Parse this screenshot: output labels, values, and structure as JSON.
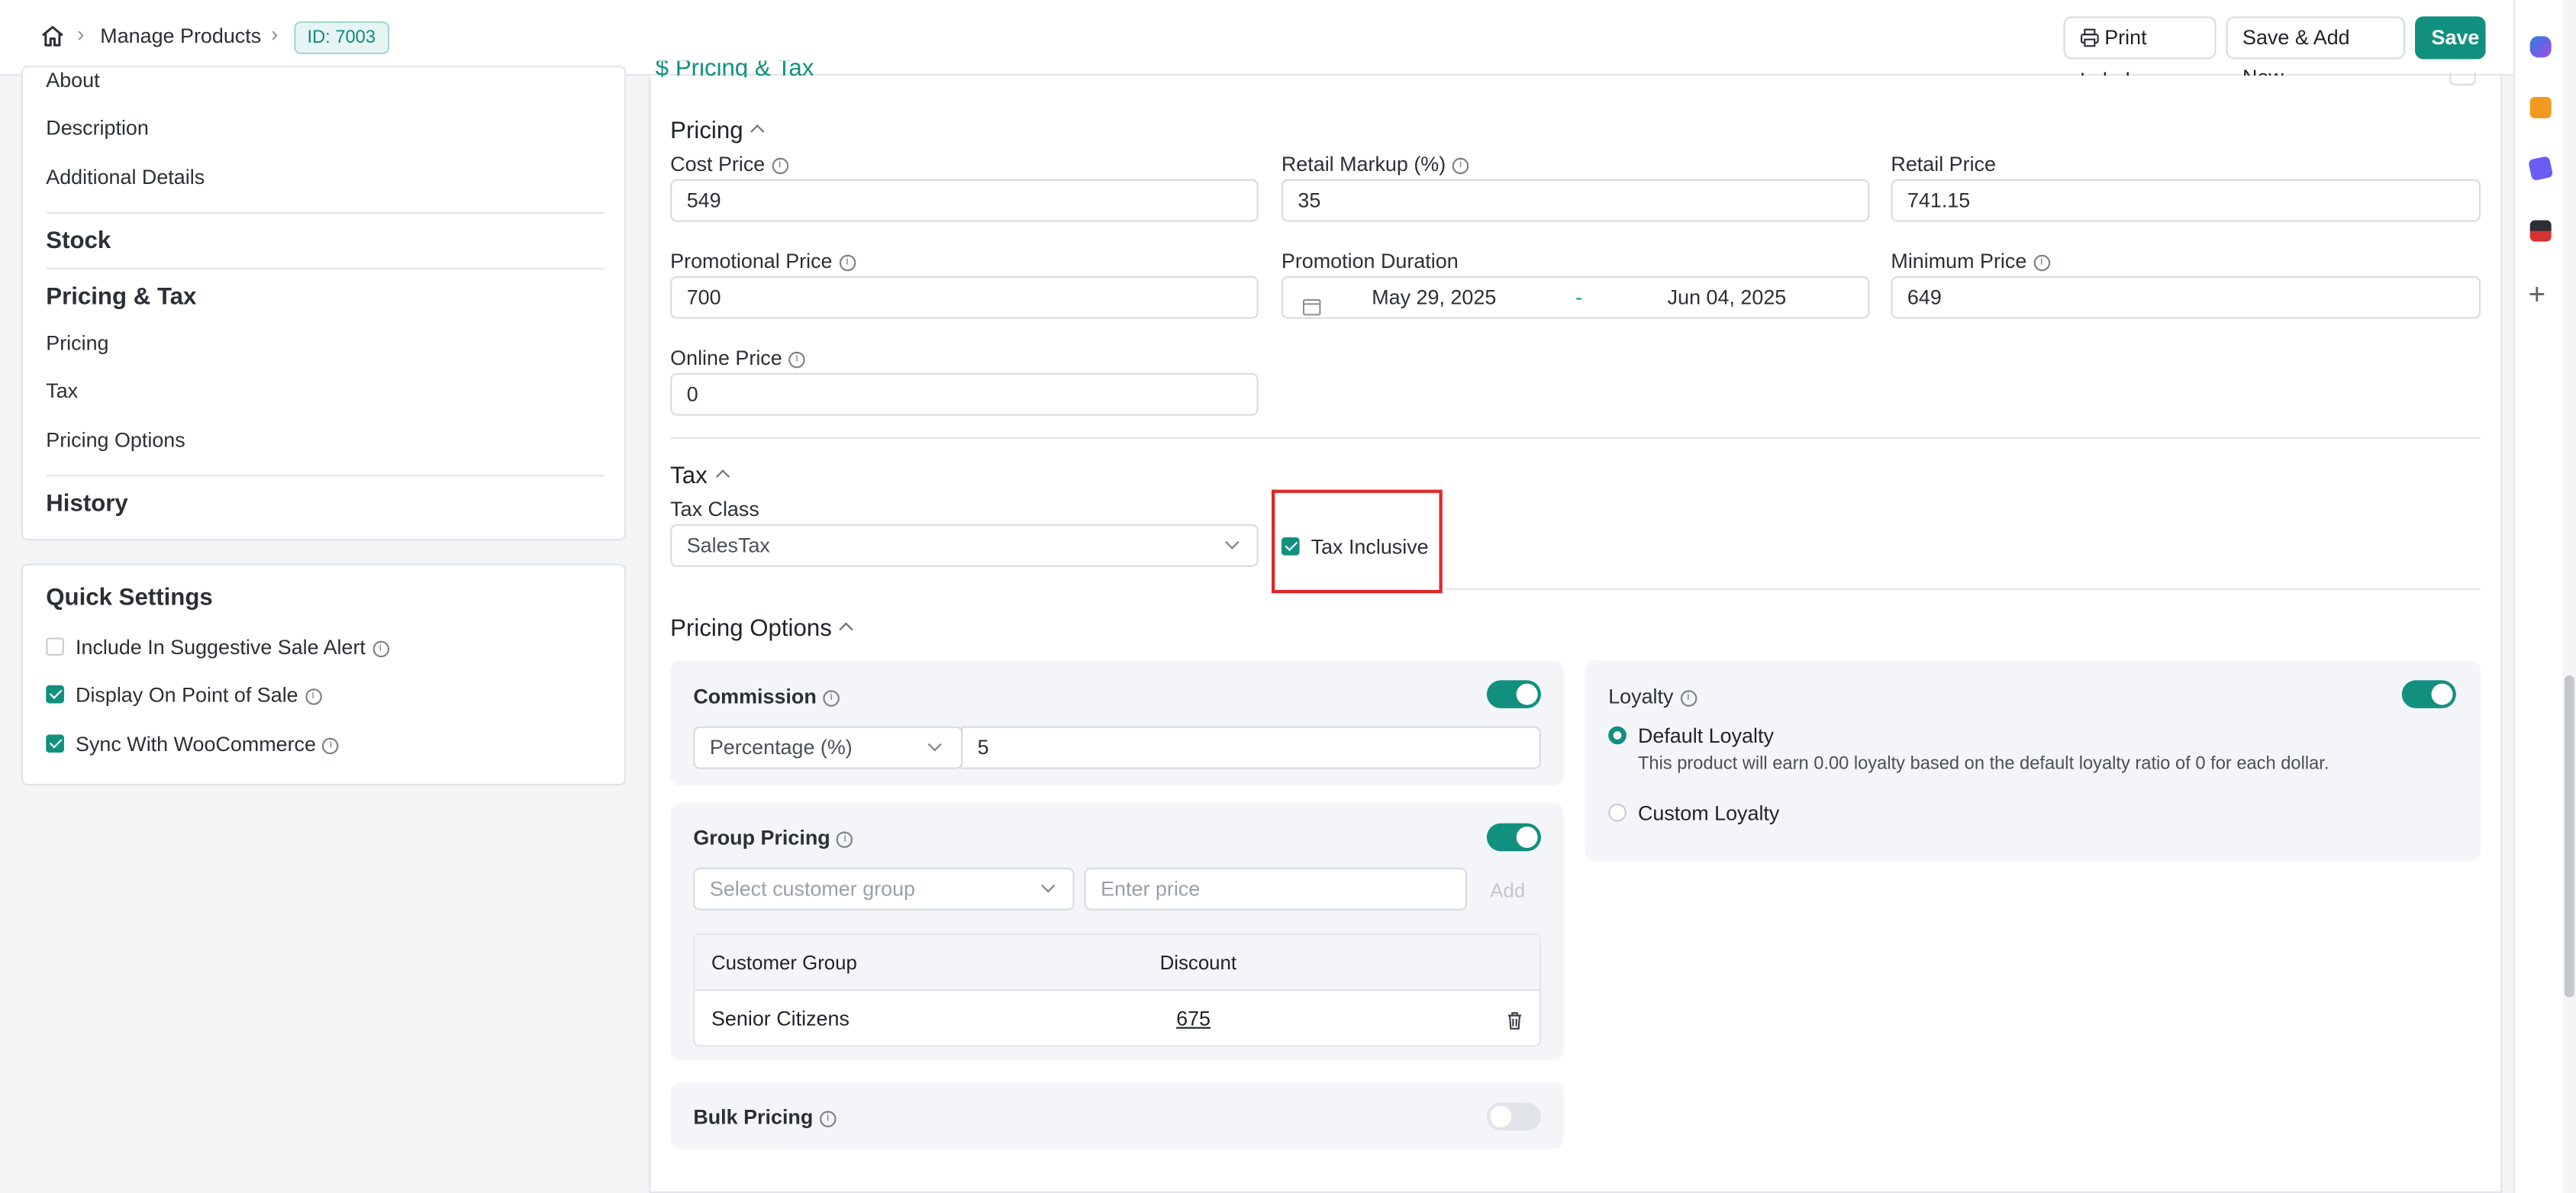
{
  "header": {
    "breadcrumb_label": "Manage Products",
    "id_badge": "ID: 7003",
    "print_label": "Print Label",
    "save_add_new": "Save & Add New",
    "save": "Save"
  },
  "sidebar": {
    "items_top": [
      "About",
      "Description",
      "Additional Details"
    ],
    "stock": "Stock",
    "pricing_tax": "Pricing & Tax",
    "items_pricing": [
      "Pricing",
      "Tax",
      "Pricing Options"
    ],
    "history": "History"
  },
  "quick_settings": {
    "title": "Quick Settings",
    "options": [
      {
        "label": "Include In Suggestive Sale Alert",
        "checked": false
      },
      {
        "label": "Display On Point of Sale",
        "checked": true
      },
      {
        "label": "Sync With WooCommerce",
        "checked": true
      }
    ]
  },
  "main": {
    "section_title_partial": "$ Pricing & Tax",
    "pricing": {
      "title": "Pricing",
      "cost_price_label": "Cost Price",
      "cost_price": "549",
      "retail_markup_label": "Retail Markup (%)",
      "retail_markup": "35",
      "retail_price_label": "Retail Price",
      "retail_price": "741.15",
      "promo_price_label": "Promotional Price",
      "promo_price": "700",
      "promo_duration_label": "Promotion Duration",
      "promo_start": "May 29, 2025",
      "promo_dash": "-",
      "promo_end": "Jun 04, 2025",
      "min_price_label": "Minimum Price",
      "min_price": "649",
      "online_price_label": "Online Price",
      "online_price": "0"
    },
    "tax": {
      "title": "Tax",
      "tax_class_label": "Tax Class",
      "tax_class": "SalesTax",
      "tax_inclusive_label": "Tax Inclusive",
      "tax_inclusive": true
    },
    "pricing_options": {
      "title": "Pricing Options",
      "commission": {
        "title": "Commission",
        "enabled": true,
        "type": "Percentage (%)",
        "value": "5"
      },
      "group_pricing": {
        "title": "Group Pricing",
        "enabled": true,
        "select_placeholder": "Select customer group",
        "price_placeholder": "Enter price",
        "add_label": "Add",
        "col_group": "Customer Group",
        "col_discount": "Discount",
        "rows": [
          {
            "group": "Senior Citizens",
            "discount": "675"
          }
        ]
      },
      "bulk_pricing": {
        "title": "Bulk Pricing",
        "enabled": false
      },
      "loyalty": {
        "title": "Loyalty",
        "enabled": true,
        "default_label": "Default Loyalty",
        "default_desc": "This product will earn 0.00 loyalty based on the default loyalty ratio of 0 for each dollar.",
        "custom_label": "Custom Loyalty",
        "selected": "default"
      }
    }
  },
  "colors": {
    "accent": "#12907f",
    "highlight": "#e02828"
  }
}
